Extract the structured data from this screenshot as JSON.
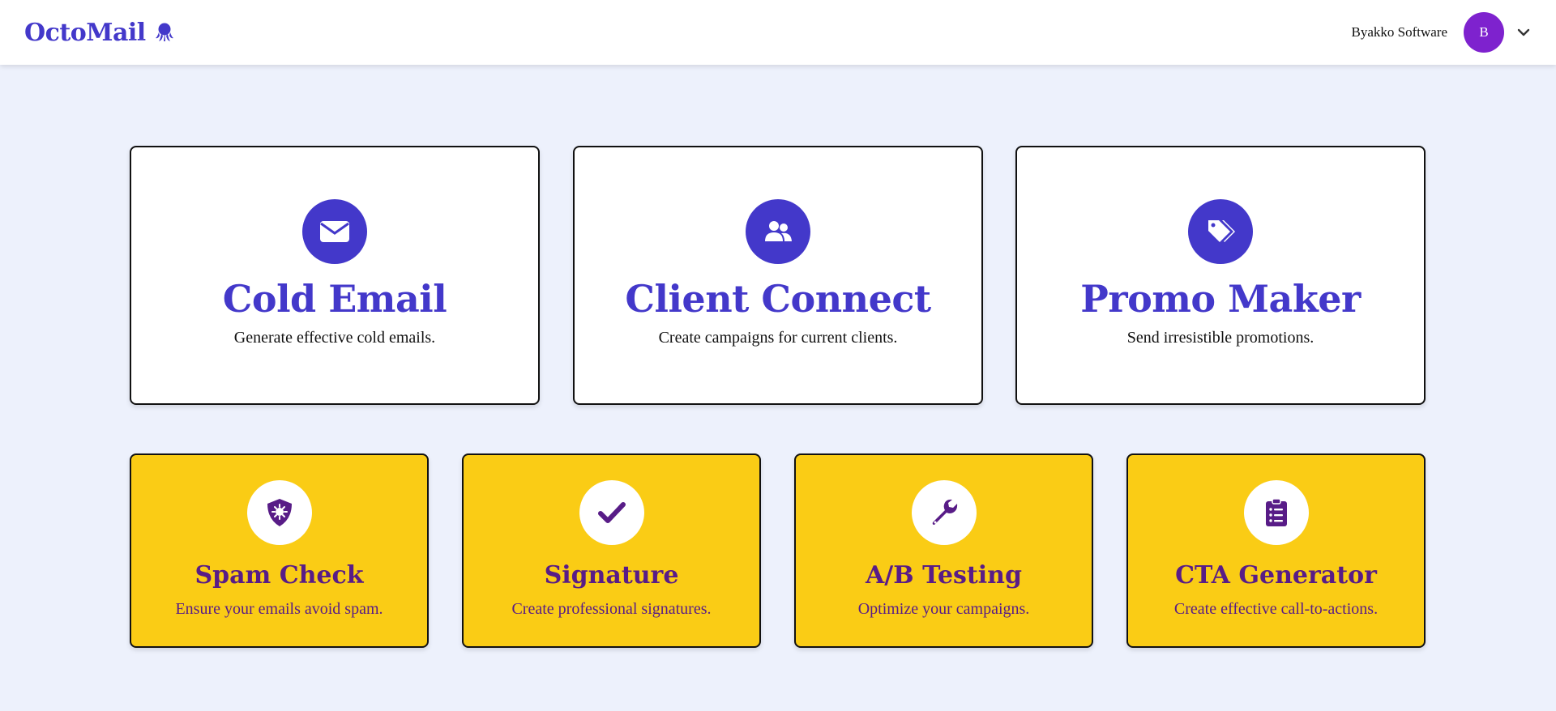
{
  "app": {
    "name": "OctoMail",
    "logo_icon": "octopus-icon"
  },
  "account": {
    "org_name": "Byakko Software",
    "avatar_initial": "B",
    "menu_icon": "chevron-down-icon"
  },
  "colors": {
    "page_bg": "#edf1fc",
    "brand": "#4338ca",
    "avatar": "#7e22ce",
    "tool_card_bg": "#facc15",
    "tool_text": "#581c87"
  },
  "main_cards": [
    {
      "title": "Cold Email",
      "description": "Generate effective cold emails.",
      "icon": "envelope-icon"
    },
    {
      "title": "Client Connect",
      "description": "Create campaigns for current clients.",
      "icon": "users-icon"
    },
    {
      "title": "Promo Maker",
      "description": "Send irresistible promotions.",
      "icon": "tags-icon"
    }
  ],
  "tool_cards": [
    {
      "title": "Spam Check",
      "description": "Ensure your emails avoid spam.",
      "icon": "shield-virus-icon"
    },
    {
      "title": "Signature",
      "description": "Create professional signatures.",
      "icon": "checkmark-icon"
    },
    {
      "title": "A/B Testing",
      "description": "Optimize your campaigns.",
      "icon": "wrench-icon"
    },
    {
      "title": "CTA Generator",
      "description": "Create effective call-to-actions.",
      "icon": "clipboard-list-icon"
    }
  ]
}
